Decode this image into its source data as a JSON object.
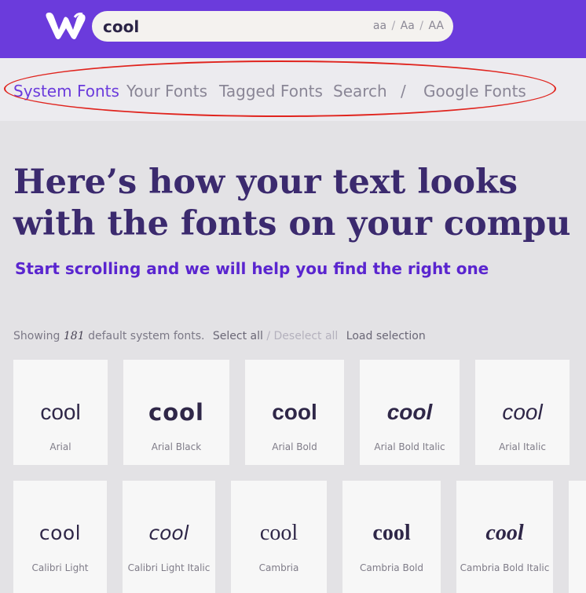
{
  "search": {
    "value": "cool",
    "case_options": [
      "aa",
      "Aa",
      "AA"
    ]
  },
  "nav": {
    "items": [
      "System Fonts",
      "Your Fonts",
      "Tagged Fonts",
      "Search",
      "/",
      "Google Fonts"
    ],
    "active": "System Fonts"
  },
  "hero": {
    "line1": "Here’s how your text looks",
    "line2": "with the fonts on your compu",
    "subhead": "Start scrolling and we will help you find the right one"
  },
  "summary": {
    "prefix": "Showing",
    "count": "181",
    "suffix": "default system fonts.",
    "select_all": "Select all",
    "deselect_all": "/ Deselect all",
    "load_selection": "Load selection"
  },
  "cards": [
    {
      "sample": "cool",
      "name": "Arial"
    },
    {
      "sample": "cool",
      "name": "Arial Black"
    },
    {
      "sample": "cool",
      "name": "Arial Bold"
    },
    {
      "sample": "cool",
      "name": "Arial Bold Italic"
    },
    {
      "sample": "cool",
      "name": "Arial Italic"
    },
    {
      "sample": "cool",
      "name": "Calibri Light"
    },
    {
      "sample": "cool",
      "name": "Calibri Light Italic"
    },
    {
      "sample": "cool",
      "name": "Cambria"
    },
    {
      "sample": "cool",
      "name": "Cambria Bold"
    },
    {
      "sample": "cool",
      "name": "Cambria Bold Italic"
    }
  ],
  "colors": {
    "brand": "#6b3bdc",
    "heading": "#3b2a6e",
    "annotation": "#e0241e"
  }
}
